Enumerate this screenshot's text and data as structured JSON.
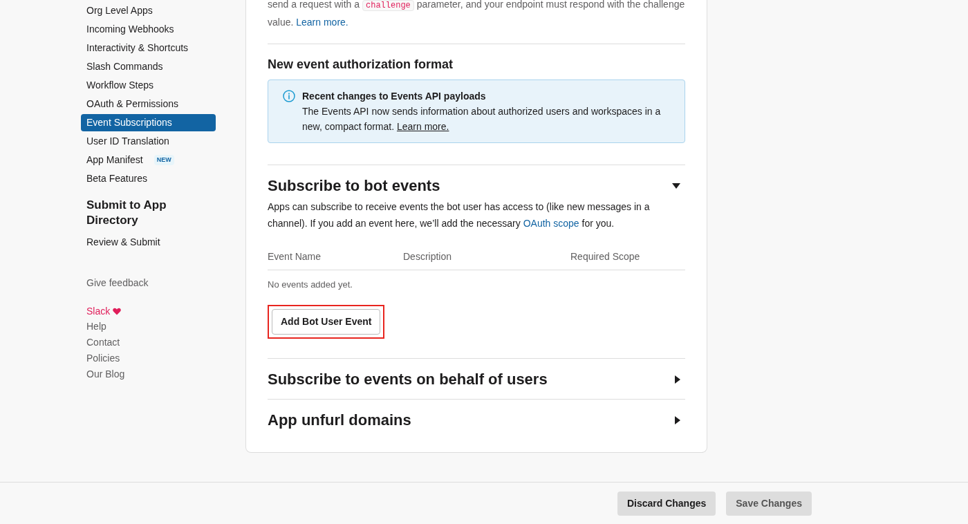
{
  "sidebar": {
    "items": [
      {
        "label": "Org Level Apps",
        "selected": false
      },
      {
        "label": "Incoming Webhooks",
        "selected": false
      },
      {
        "label": "Interactivity & Shortcuts",
        "selected": false
      },
      {
        "label": "Slash Commands",
        "selected": false
      },
      {
        "label": "Workflow Steps",
        "selected": false
      },
      {
        "label": "OAuth & Permissions",
        "selected": false
      },
      {
        "label": "Event Subscriptions",
        "selected": true
      },
      {
        "label": "User ID Translation",
        "selected": false
      },
      {
        "label": "App Manifest",
        "selected": false,
        "badge": "NEW"
      },
      {
        "label": "Beta Features",
        "selected": false
      }
    ],
    "section_heading": "Submit to App Directory",
    "section_items": [
      {
        "label": "Review & Submit",
        "selected": false
      }
    ],
    "feedback": "Give feedback",
    "footer_links": [
      {
        "label": "Slack",
        "kind": "brand"
      },
      {
        "label": "Help",
        "kind": "link"
      },
      {
        "label": "Contact",
        "kind": "link"
      },
      {
        "label": "Policies",
        "kind": "link"
      },
      {
        "label": "Our Blog",
        "kind": "link"
      }
    ]
  },
  "intro": {
    "before": "send a request with a",
    "code": "challenge",
    "after": "parameter, and your endpoint must respond with the challenge value.",
    "link": "Learn more."
  },
  "auth_format": {
    "title": "New event authorization format",
    "callout": {
      "title": "Recent changes to Events API payloads",
      "text": "The Events API now sends information about authorized users and workspaces in a new, compact format.",
      "link": "Learn more."
    }
  },
  "sections": [
    {
      "title": "Subscribe to bot events",
      "expanded": true,
      "description": "Apps can subscribe to receive events the bot user has access to (like new messages in a channel). If you add an event here, we’ll add the necessary",
      "link": "OAuth scope",
      "description_end": "for you.",
      "table": {
        "columns": [
          "Event Name",
          "Description",
          "Required Scope"
        ],
        "empty": "No events added yet."
      },
      "button": {
        "label": "Add Bot User Event",
        "highlighted": true
      }
    },
    {
      "title": "Subscribe to events on behalf of users",
      "expanded": false
    },
    {
      "title": "App unfurl domains",
      "expanded": false
    }
  ],
  "footer": {
    "buttons": [
      {
        "label": "Discard Changes",
        "disabled": false
      },
      {
        "label": "Save Changes",
        "disabled": true
      }
    ]
  }
}
